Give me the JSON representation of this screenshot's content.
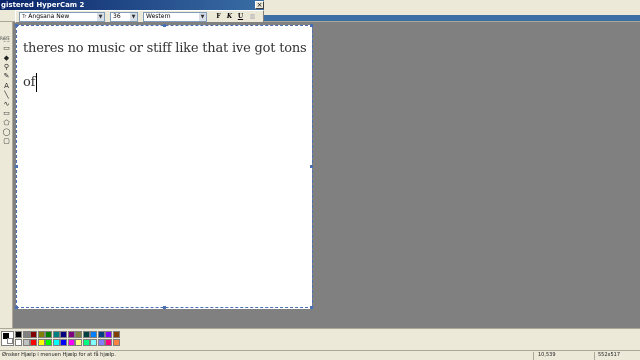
{
  "window": {
    "title_fragment": "gistered HyperCam 2",
    "close_glyph": "×"
  },
  "toolbox": {
    "edge_label": "Redi",
    "tools": [
      {
        "name": "select-tool-icon",
        "glyph": "⬚"
      },
      {
        "name": "eraser-tool-icon",
        "glyph": "▭"
      },
      {
        "name": "fill-tool-icon",
        "glyph": "◆"
      },
      {
        "name": "magnifier-tool-icon",
        "glyph": "⚲"
      },
      {
        "name": "pencil-tool-icon",
        "glyph": "✎"
      },
      {
        "name": "text-tool-icon",
        "glyph": "A"
      },
      {
        "name": "line-tool-icon",
        "glyph": "╲"
      },
      {
        "name": "curve-tool-icon",
        "glyph": "∿"
      },
      {
        "name": "rectangle-tool-icon",
        "glyph": "▭"
      },
      {
        "name": "polygon-tool-icon",
        "glyph": "⬠"
      },
      {
        "name": "ellipse-tool-icon",
        "glyph": "◯"
      },
      {
        "name": "rounded-rect-tool-icon",
        "glyph": "▢"
      }
    ]
  },
  "font_toolbar": {
    "font_name": "Angsana New",
    "font_size": "36",
    "script": "Western",
    "bold_label": "F",
    "italic_label": "K",
    "underline_label": "U",
    "vertical_label": "▥",
    "dropdown_arrow": "▼",
    "font_icon": "Tr"
  },
  "canvas": {
    "line_1": "theres no music or stiff like that ive got tons",
    "line_2": "of"
  },
  "palette": {
    "colors": [
      "#000000",
      "#808080",
      "#800000",
      "#808000",
      "#008000",
      "#008080",
      "#000080",
      "#800080",
      "#808040",
      "#004040",
      "#0080ff",
      "#004080",
      "#8000ff",
      "#804000",
      "#ffffff",
      "#c0c0c0",
      "#ff0000",
      "#ffff00",
      "#00ff00",
      "#00ffff",
      "#0000ff",
      "#ff00ff",
      "#ffff80",
      "#00ff80",
      "#80ffff",
      "#8080ff",
      "#ff0080",
      "#ff8040"
    ]
  },
  "status": {
    "help_text": "Ønsker Hjælp i menuen Hjælp for at få hjælp.",
    "coords": "10,539",
    "size": "552x517"
  }
}
